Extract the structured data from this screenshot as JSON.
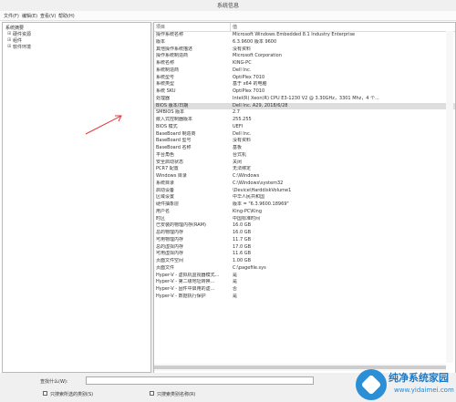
{
  "window": {
    "title": "系统信息"
  },
  "menu": [
    "文件(F)",
    "编辑(E)",
    "查看(V)",
    "帮助(H)"
  ],
  "tree": {
    "root": "系统摘要",
    "children": [
      {
        "expander": "⊞",
        "label": "硬件资源"
      },
      {
        "expander": "⊞",
        "label": "组件"
      },
      {
        "expander": "⊞",
        "label": "软件环境"
      }
    ]
  },
  "table": {
    "headers": [
      "项目",
      "值"
    ],
    "rows": [
      {
        "item": "操作系统名称",
        "value": "Microsoft Windows Embedded 8.1 Industry Enterprise"
      },
      {
        "item": "版本",
        "value": "6.3.9600 版本 9600"
      },
      {
        "item": "其他操作系统描述",
        "value": "没有资料"
      },
      {
        "item": "操作系统制造商",
        "value": "Microsoft Corporation"
      },
      {
        "item": "系统名称",
        "value": "KING-PC"
      },
      {
        "item": "系统制造商",
        "value": "Dell Inc."
      },
      {
        "item": "系统型号",
        "value": "OptiPlex 7010"
      },
      {
        "item": "系统类型",
        "value": "基于 x64 的电脑"
      },
      {
        "item": "系统 SKU",
        "value": "OptiPlex 7010"
      },
      {
        "item": "处理器",
        "value": "Intel(R) Xeon(R) CPU E3-1230 V2 @ 3.30GHz，3301 Mhz，4 个..."
      },
      {
        "item": "BIOS 版本/日期",
        "value": "Dell Inc. A29, 2018/6/28"
      },
      {
        "item": "SMBIOS 版本",
        "value": "2.7"
      },
      {
        "item": "嵌入式控制器版本",
        "value": "255.255"
      },
      {
        "item": "BIOS 模式",
        "value": "UEFI"
      },
      {
        "item": "BaseBoard 制造商",
        "value": "Dell Inc."
      },
      {
        "item": "BaseBoard 型号",
        "value": "没有资料"
      },
      {
        "item": "BaseBoard 名称",
        "value": "基板"
      },
      {
        "item": "平台角色",
        "value": "台式机"
      },
      {
        "item": "安全启动状态",
        "value": "关闭"
      },
      {
        "item": "PCR7 配置",
        "value": "无法绑定"
      },
      {
        "item": "Windows 目录",
        "value": "C:\\Windows"
      },
      {
        "item": "系统目录",
        "value": "C:\\Windows\\system32"
      },
      {
        "item": "启动设备",
        "value": "\\Device\\HarddiskVolume1"
      },
      {
        "item": "区域设置",
        "value": "中华人民共和国"
      },
      {
        "item": "硬件抽象层",
        "value": "版本 = \"6.3.9600.18969\""
      },
      {
        "item": "用户名",
        "value": "King-PC\\King"
      },
      {
        "item": "时区",
        "value": "中国标准时间"
      },
      {
        "item": "已安装的物理内存(RAM)",
        "value": "16.0 GB"
      },
      {
        "item": "总的物理内存",
        "value": "16.0 GB"
      },
      {
        "item": "可用物理内存",
        "value": "11.7 GB"
      },
      {
        "item": "总的虚拟内存",
        "value": "17.0 GB"
      },
      {
        "item": "可用虚拟内存",
        "value": "11.6 GB"
      },
      {
        "item": "页面文件空间",
        "value": "1.00 GB"
      },
      {
        "item": "页面文件",
        "value": "C:\\pagefile.sys"
      },
      {
        "item": "Hyper-V - 虚拟机监视器模式...",
        "value": "是"
      },
      {
        "item": "Hyper-V - 第二级地址转换...",
        "value": "是"
      },
      {
        "item": "Hyper-V - 固件中启用的虚...",
        "value": "否"
      },
      {
        "item": "Hyper-V - 数据执行保护",
        "value": "是"
      }
    ],
    "selected_row": 10
  },
  "find": {
    "label": "查找什么(W):",
    "value": "",
    "option1": "只搜索所选的类别(S)",
    "option2": "只搜索类别名称(R)"
  },
  "watermark": {
    "text": "纯净系统家园",
    "url": "www.yidaimei.com"
  },
  "colors": {
    "selected_row": "#dedede",
    "arrow": "#e53935",
    "watermark": "#1e79c4"
  }
}
